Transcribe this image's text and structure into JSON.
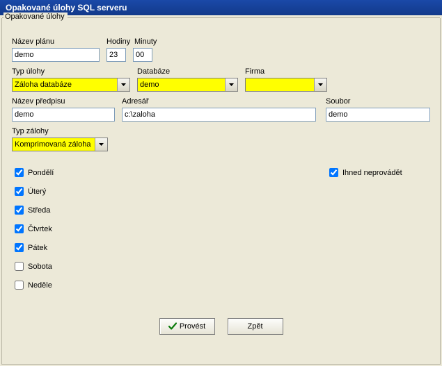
{
  "window": {
    "title": "Opakované úlohy SQL serveru"
  },
  "group": {
    "title": "Opakované úlohy"
  },
  "labels": {
    "nazev_planu": "Název plánu",
    "hodiny": "Hodiny",
    "minuty": "Minuty",
    "typ_ulohy": "Typ úlohy",
    "databaze": "Databáze",
    "firma": "Firma",
    "nazev_predpisu": "Název předpisu",
    "adresar": "Adresář",
    "soubor": "Soubor",
    "typ_zalohy": "Typ zálohy"
  },
  "values": {
    "nazev_planu": "demo",
    "hodiny": "23",
    "minuty": "00",
    "typ_ulohy": "Záloha databáze",
    "databaze": "demo",
    "firma": "",
    "nazev_predpisu": "demo",
    "adresar": "c:\\zaloha",
    "soubor": "demo",
    "typ_zalohy": "Komprimovaná záloha"
  },
  "days": {
    "pondeli": "Pondělí",
    "utery": "Úterý",
    "streda": "Středa",
    "ctvrtek": "Čtvrtek",
    "patek": "Pátek",
    "sobota": "Sobota",
    "nedele": "Neděle"
  },
  "options": {
    "ihned_neprovadet": "Ihned neprovádět"
  },
  "buttons": {
    "provest": "Provést",
    "zpet": "Zpět"
  }
}
